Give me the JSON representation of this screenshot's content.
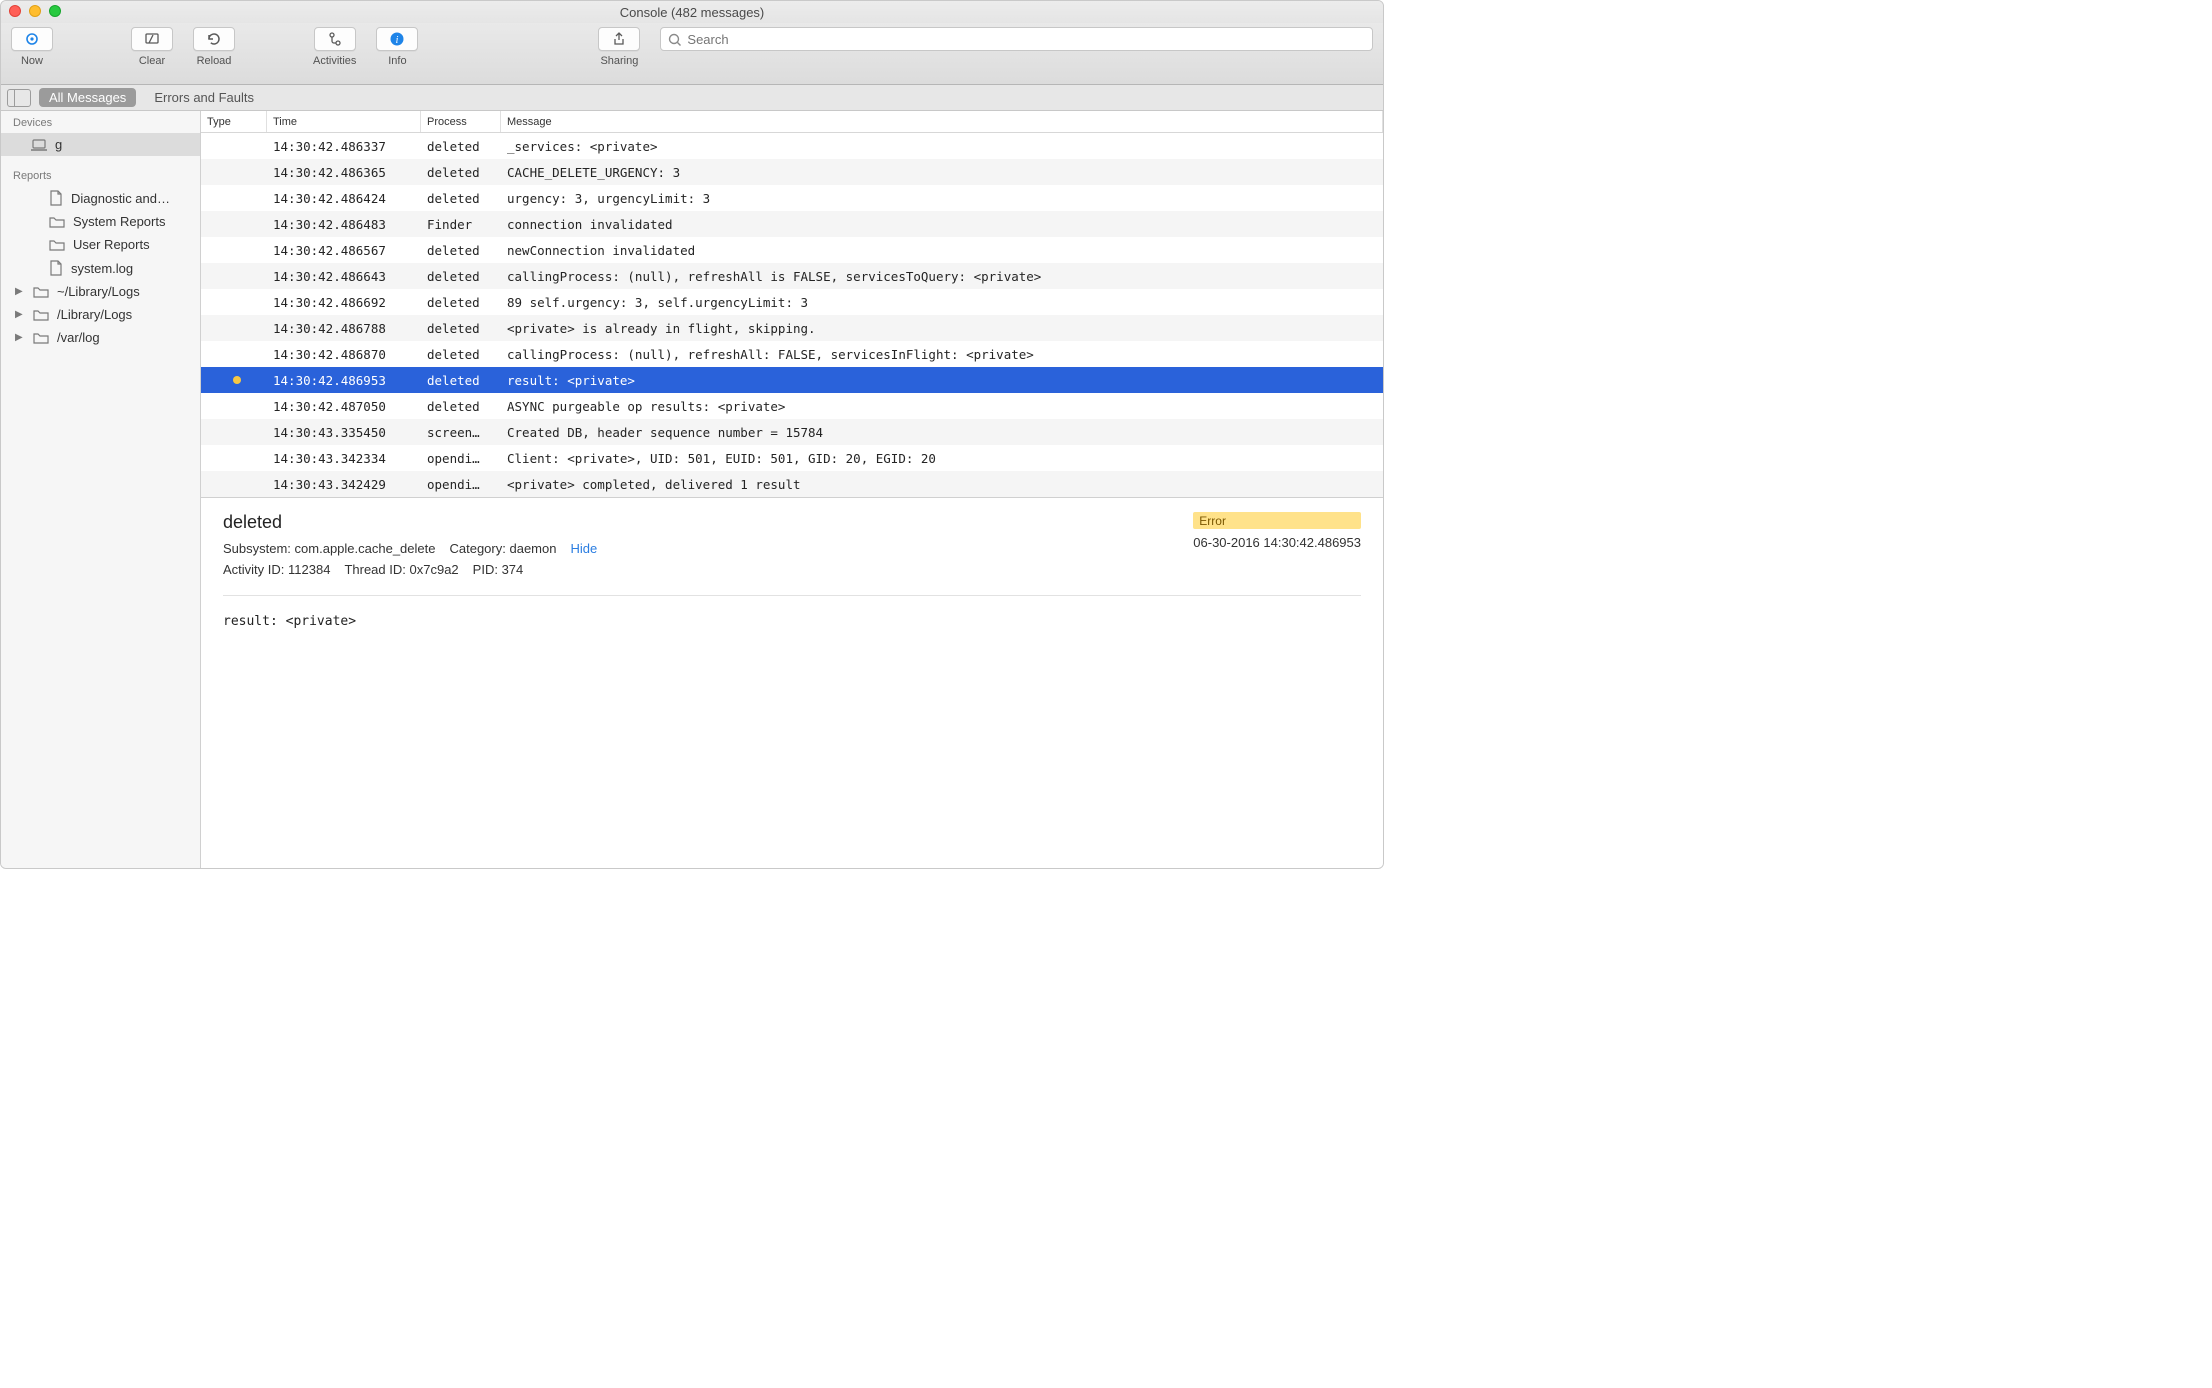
{
  "window": {
    "title": "Console (482 messages)"
  },
  "toolbar": {
    "now": "Now",
    "clear": "Clear",
    "reload": "Reload",
    "activities": "Activities",
    "info": "Info",
    "sharing": "Sharing",
    "search_placeholder": "Search"
  },
  "filter": {
    "all_messages": "All Messages",
    "errors_faults": "Errors and Faults"
  },
  "sidebar": {
    "devices_hdr": "Devices",
    "device_name": "g",
    "reports_hdr": "Reports",
    "items": [
      {
        "label": "Diagnostic and…",
        "icon": "doc",
        "arrow": false,
        "indent": true
      },
      {
        "label": "System Reports",
        "icon": "folder",
        "arrow": false,
        "indent": true
      },
      {
        "label": "User Reports",
        "icon": "folder",
        "arrow": false,
        "indent": true
      },
      {
        "label": "system.log",
        "icon": "doc",
        "arrow": false,
        "indent": true
      },
      {
        "label": "~/Library/Logs",
        "icon": "folder",
        "arrow": true,
        "indent": false
      },
      {
        "label": "/Library/Logs",
        "icon": "folder",
        "arrow": true,
        "indent": false
      },
      {
        "label": "/var/log",
        "icon": "folder",
        "arrow": true,
        "indent": false
      }
    ]
  },
  "columns": {
    "type": "Type",
    "time": "Time",
    "process": "Process",
    "message": "Message"
  },
  "rows": [
    {
      "dot": "",
      "time": "14:30:42.486337",
      "process": "deleted",
      "message": "_services: <private>"
    },
    {
      "dot": "",
      "time": "14:30:42.486365",
      "process": "deleted",
      "message": "CACHE_DELETE_URGENCY: 3"
    },
    {
      "dot": "",
      "time": "14:30:42.486424",
      "process": "deleted",
      "message": "urgency: 3, urgencyLimit: 3"
    },
    {
      "dot": "",
      "time": "14:30:42.486483",
      "process": "Finder",
      "message": "connection invalidated"
    },
    {
      "dot": "",
      "time": "14:30:42.486567",
      "process": "deleted",
      "message": "newConnection invalidated"
    },
    {
      "dot": "",
      "time": "14:30:42.486643",
      "process": "deleted",
      "message": "callingProcess: (null), refreshAll is FALSE, servicesToQuery: <private>"
    },
    {
      "dot": "",
      "time": "14:30:42.486692",
      "process": "deleted",
      "message": "89 self.urgency: 3, self.urgencyLimit: 3"
    },
    {
      "dot": "",
      "time": "14:30:42.486788",
      "process": "deleted",
      "message": "<private> is already in flight, skipping."
    },
    {
      "dot": "",
      "time": "14:30:42.486870",
      "process": "deleted",
      "message": "callingProcess: (null), refreshAll: FALSE, servicesInFlight: <private>"
    },
    {
      "dot": "yellow",
      "time": "14:30:42.486953",
      "process": "deleted",
      "message": "result: <private>",
      "selected": true
    },
    {
      "dot": "",
      "time": "14:30:42.487050",
      "process": "deleted",
      "message": "ASYNC purgeable op results: <private>"
    },
    {
      "dot": "",
      "time": "14:30:43.335450",
      "process": "screen…",
      "message": "Created DB, header sequence number = 15784"
    },
    {
      "dot": "",
      "time": "14:30:43.342334",
      "process": "opendi…",
      "message": "Client: <private>, UID: 501, EUID: 501, GID: 20, EGID: 20"
    },
    {
      "dot": "",
      "time": "14:30:43.342429",
      "process": "opendi…",
      "message": "<private> completed, delivered 1 result"
    }
  ],
  "detail": {
    "title": "deleted",
    "subsystem_lbl": "Subsystem:",
    "subsystem_val": "com.apple.cache_delete",
    "category_lbl": "Category:",
    "category_val": "daemon",
    "hide": "Hide",
    "activity_lbl": "Activity ID:",
    "activity_val": "112384",
    "thread_lbl": "Thread ID:",
    "thread_val": "0x7c9a2",
    "pid_lbl": "PID:",
    "pid_val": "374",
    "badge": "Error",
    "timestamp": "06-30-2016 14:30:42.486953",
    "body": "result: <private>"
  }
}
